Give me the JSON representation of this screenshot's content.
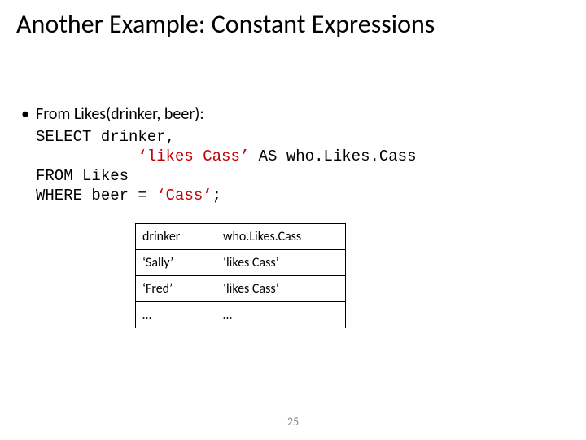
{
  "title": "Another Example: Constant Expressions",
  "bullet1": "From Likes(drinker, beer):",
  "code": {
    "l1a": "SELECT drinker,",
    "l2a": "           ",
    "l2b": "‘likes Cass’",
    "l2c": " AS who.Likes.Cass",
    "l3a": "FROM Likes",
    "l4a": "WHERE beer = ",
    "l4b": "‘Cass’",
    "l4c": ";"
  },
  "table": {
    "h0": "drinker",
    "h1": "who.Likes.Cass",
    "r1c0": "‘Sally’",
    "r1c1": "‘likes Cass’",
    "r2c0": "‘Fred’",
    "r2c1": "‘likes Cass’",
    "r3c0": "…",
    "r3c1": "…"
  },
  "pagenum": "25",
  "chart_data": {
    "type": "table",
    "columns": [
      "drinker",
      "who.Likes.Cass"
    ],
    "rows": [
      [
        "‘Sally’",
        "‘likes Cass’"
      ],
      [
        "‘Fred’",
        "‘likes Cass’"
      ],
      [
        "…",
        "…"
      ]
    ]
  }
}
